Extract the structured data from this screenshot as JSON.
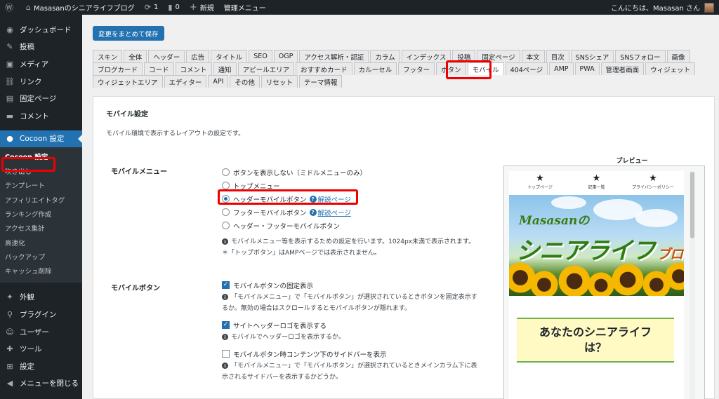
{
  "adminbar": {
    "site_name": "Masasanのシニアライフブログ",
    "updates_count": "1",
    "comments_count": "0",
    "new_label": "新規",
    "manage_menu": "管理メニュー",
    "greeting": "こんにちは、Masasan さん"
  },
  "sidebar": {
    "items_top": [
      {
        "icon": "dashboard-icon",
        "glyph": "◉",
        "label": "ダッシュボード"
      },
      {
        "icon": "pin-icon",
        "glyph": "✎",
        "label": "投稿"
      },
      {
        "icon": "media-icon",
        "glyph": "▣",
        "label": "メディア"
      },
      {
        "icon": "link-icon",
        "glyph": "⛓",
        "label": "リンク"
      },
      {
        "icon": "page-icon",
        "glyph": "▤",
        "label": "固定ページ"
      },
      {
        "icon": "comment-icon",
        "glyph": "▬",
        "label": "コメント"
      }
    ],
    "current": {
      "icon": "cocoon-icon",
      "glyph": "●",
      "label": "Cocoon 設定"
    },
    "submenu": [
      "Cocoon 設定",
      "吹き出し",
      "テンプレート",
      "アフィリエイトタグ",
      "ランキング作成",
      "アクセス集計",
      "高速化",
      "バックアップ",
      "キャッシュ削除"
    ],
    "items_bottom": [
      {
        "icon": "appearance-icon",
        "glyph": "✦",
        "label": "外観"
      },
      {
        "icon": "plugin-icon",
        "glyph": "⚲",
        "label": "プラグイン"
      },
      {
        "icon": "users-icon",
        "glyph": "☺",
        "label": "ユーザー"
      },
      {
        "icon": "tools-icon",
        "glyph": "✚",
        "label": "ツール"
      },
      {
        "icon": "settings-icon",
        "glyph": "⊞",
        "label": "設定"
      },
      {
        "icon": "collapse-icon",
        "glyph": "◀",
        "label": "メニューを閉じる"
      }
    ]
  },
  "save_button": "変更をまとめて保存",
  "tabs": {
    "row1": [
      "スキン",
      "全体",
      "ヘッダー",
      "広告",
      "タイトル",
      "SEO",
      "OGP",
      "アクセス解析・認証",
      "カラム",
      "インデックス",
      "投稿",
      "固定ページ",
      "本文",
      "目次",
      "SNSシェア",
      "SNSフォロー",
      "画像"
    ],
    "row2": [
      "ブログカード",
      "コード",
      "コメント",
      "通知",
      "アピールエリア",
      "おすすめカード",
      "カルーセル",
      "フッター",
      "ボタン",
      "モバイル",
      "404ページ",
      "AMP",
      "PWA",
      "管理者画面",
      "ウィジェット"
    ],
    "row3": [
      "ウィジェットエリア",
      "エディター",
      "API",
      "その他",
      "リセット",
      "テーマ情報"
    ],
    "active": "モバイル"
  },
  "panel": {
    "title": "モバイル設定",
    "description": "モバイル環境で表示するレイアウトの設定です。",
    "mobile_menu": {
      "label": "モバイルメニュー",
      "options": [
        {
          "label": "ボタンを表示しない（ミドルメニューのみ）",
          "checked": false,
          "help": ""
        },
        {
          "label": "トップメニュー",
          "checked": false,
          "help": ""
        },
        {
          "label": "ヘッダーモバイルボタン",
          "checked": true,
          "help": "解説ページ"
        },
        {
          "label": "フッターモバイルボタン",
          "checked": false,
          "help": "解説ページ"
        },
        {
          "label": "ヘッダー・フッターモバイルボタン",
          "checked": false,
          "help": ""
        }
      ],
      "note1": "モバイルメニュー等を表示するための設定を行います。1024px未満で表示されます。",
      "note2": "＊「トップボタン」はAMPページでは表示されません。"
    },
    "mobile_button": {
      "label": "モバイルボタン",
      "cb1_label": "モバイルボタンの固定表示",
      "cb1_checked": true,
      "cb1_note_a": "「モバイルメニュー」で「モバイルボタン」が選択されているときボタンを固定表示す",
      "cb1_note_b": "るか。無効の場合はスクロールするとモバイルボタンが隠れます。",
      "cb2_label": "サイトヘッダーロゴを表示する",
      "cb2_checked": true,
      "cb2_note": "モバイルでヘッダーロゴを表示するか。",
      "cb3_label": "モバイルボタン時コンテンツ下のサイドバーを表示",
      "cb3_checked": false,
      "cb3_note_a": "「モバイルメニュー」で「モバイルボタン」が選択されているときメインカラム下に表",
      "cb3_note_b": "示されるサイドバーを表示するかどうか。"
    },
    "preview": {
      "label": "プレビュー",
      "nav": [
        "トップページ",
        "記事一覧",
        "プライバシーポリシー"
      ],
      "brand": "Masasanの",
      "logo_main": "シニアライフ",
      "logo_sub": "ブログ",
      "box_text": "あなたのシニアライフは？"
    }
  }
}
